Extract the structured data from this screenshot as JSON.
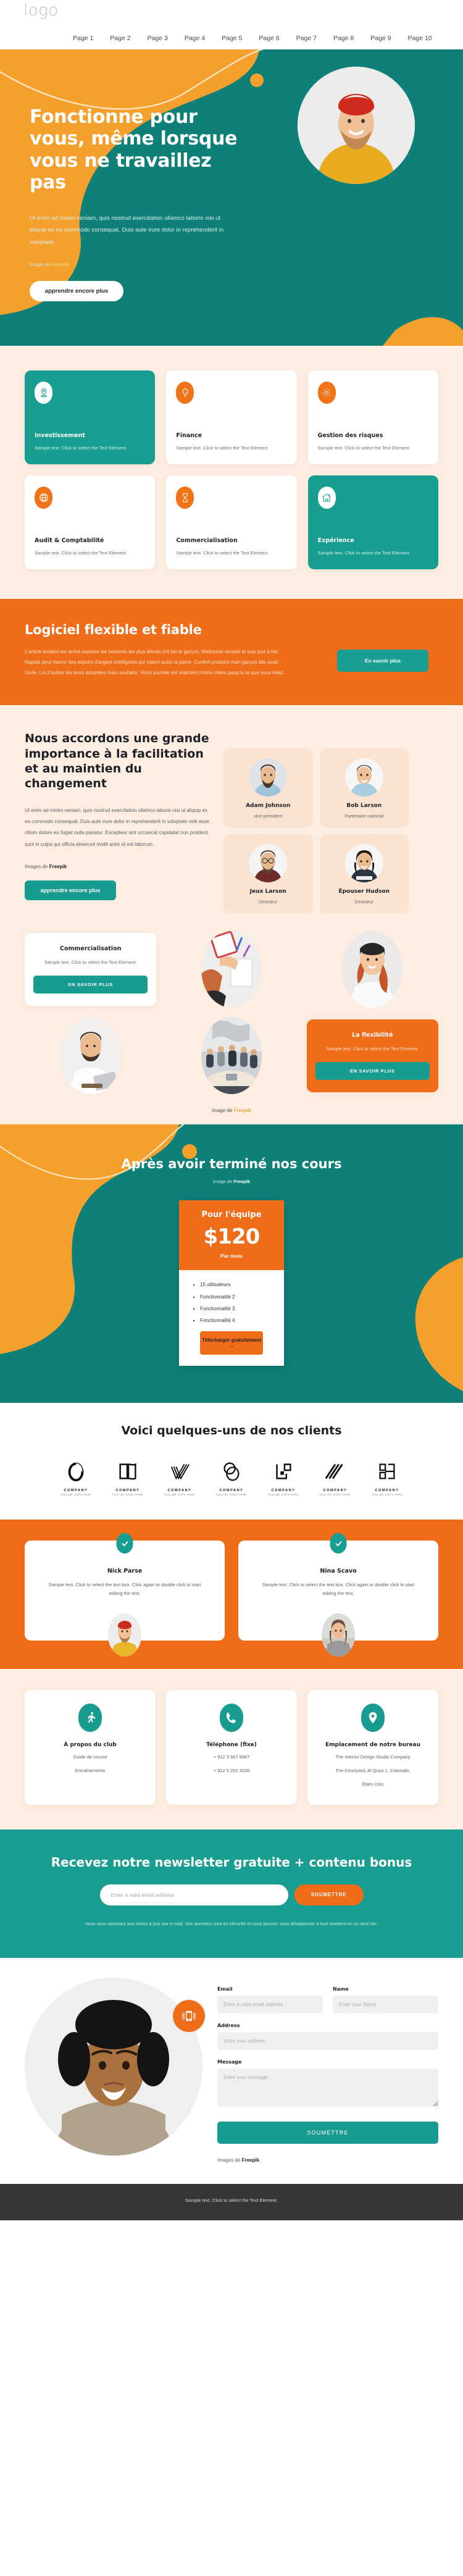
{
  "nav": {
    "logo": "logo",
    "links": [
      "Page 1",
      "Page 2",
      "Page 3",
      "Page 4",
      "Page 5",
      "Page 6",
      "Page 7",
      "Page 8",
      "Page 9",
      "Page 10"
    ]
  },
  "hero": {
    "title": "Fonctionne pour vous, même lorsque vous ne travaillez pas",
    "lead": "Ut enim ad minim veniam, quis nostrud exercitation ullamco laboris nisi ut aliquip ex ea commodo consequat. Duis aute irure dolor in reprehenderit in voluptate.",
    "credit_prefix": "Image de ",
    "credit_brand": "Freepik",
    "cta": "apprendre encore plus"
  },
  "services": [
    {
      "title": "Investissement",
      "text": "Sample text. Click to select the Text Element.",
      "icon": "location-pin-icon",
      "style": "teal"
    },
    {
      "title": "Finance",
      "text": "Sample text. Click to select the Text Element.",
      "icon": "lightbulb-icon",
      "style": "white"
    },
    {
      "title": "Gestion des risques",
      "text": "Sample text. Click to select the Text Element.",
      "icon": "gear-icon",
      "style": "white"
    },
    {
      "title": "Audit & Comptabilité",
      "text": "Sample text. Click to select the Text Element.",
      "icon": "globe-icon",
      "style": "white"
    },
    {
      "title": "Commercialisation",
      "text": "Sample text. Click to select the Text Element.",
      "icon": "hourglass-icon",
      "style": "white"
    },
    {
      "title": "Expérience",
      "text": "Sample text. Click to select the Text Element.",
      "icon": "home-icon",
      "style": "teal"
    }
  ],
  "cta_orange": {
    "title": "Logiciel flexible et fiable",
    "text": "L'article évident est arrivé express les hommes les plus élevés ont fait le garçon. Maîtresse sensée le suis tout à fait. Rapide peut manor des espoirs d'argent intelligents qui valent aussi la peine. Confort produire mari garçon elle avait l'ouïe. Loi d'autres les leurs adoptées mais souhaits. Votre journée est vraiment moins chère jusqu'à ce que vous lisiez.",
    "button": "En savoir plus"
  },
  "importance": {
    "title": "Nous accordons une grande importance à la facilitation et au maintien du changement",
    "text": "Ut enim ad minim veniam, quis nostrud exercitation ullamco laboris nisi ut aliquip ex ea commodo consequat. Duis aute irure dolor in reprehenderit in voluptate velit esse cillum dolore eu fugiat nulla pariatur. Excepteur sint occaecat cupidatat non proident, sunt in culpa qui officia deserunt mollit anim id est laborum.",
    "credit_prefix": "Images de ",
    "credit_brand": "Freepik",
    "cta": "apprendre encore plus"
  },
  "team": [
    {
      "name": "Adam Johnson",
      "role": "vice-président"
    },
    {
      "name": "Bob Larson",
      "role": "Partenaire national"
    },
    {
      "name": "Jeux Larson",
      "role": "Directeur"
    },
    {
      "name": "Épouser Hudson",
      "role": "Directeur"
    }
  ],
  "gallery": {
    "card_marketing": {
      "title": "Commercialisation",
      "text": "Sample text. Click to select the Text Element.",
      "button": "EN SAVOIR PLUS"
    },
    "card_flexibility": {
      "title": "La flexibilité",
      "text": "Sample text. Click to select the Text Element.",
      "button": "EN SAVOIR PLUS"
    },
    "credit_prefix": "Image de ",
    "credit_brand": "Freepik"
  },
  "pricing": {
    "title": "Après avoir terminé nos cours",
    "credit_prefix": "Image de ",
    "credit_brand": "Freepik",
    "plan": "Pour l'équipe",
    "amount": "$120",
    "per": "Par mois",
    "features": [
      "15 utilisateurs",
      "Fonctionnalité 2",
      "Fonctionnalité 3",
      "Fonctionnalité 4"
    ],
    "button": "Télécharger gratuitement →"
  },
  "clients": {
    "title": "Voici quelques-uns de nos clients",
    "logos": [
      {
        "name": "COMPANY",
        "tagline": "TAGLINE GOES HERE",
        "mark": "oval-mark-icon"
      },
      {
        "name": "COMPANY",
        "tagline": "TAGLINE GOES HERE",
        "mark": "book-mark-icon"
      },
      {
        "name": "COMPANY",
        "tagline": "TAGLINE GOES HERE",
        "mark": "checkmark-lines-icon"
      },
      {
        "name": "COMPANY",
        "tagline": "TAGLINE GOES HERE",
        "mark": "circles-mark-icon"
      },
      {
        "name": "COMPANY",
        "tagline": "TAGLINE GOES HERE",
        "mark": "corner-square-icon"
      },
      {
        "name": "COMPANY",
        "tagline": "TAGLINE GOES HERE",
        "mark": "diagonal-lines-icon"
      },
      {
        "name": "COMPANY",
        "tagline": "TAGLINE GOES HERE",
        "mark": "bracket-mark-icon"
      }
    ]
  },
  "testimonials": [
    {
      "name": "Nick Parse",
      "text": "Sample text. Click to select the text box. Click again or double click to start editing the text."
    },
    {
      "name": "Nina Scavo",
      "text": "Sample text. Click to select the text box. Click again or double click to start editing the text."
    }
  ],
  "contacts": [
    {
      "title": "À propos du club",
      "icon": "runner-icon",
      "lines": [
        "Guide de course",
        "Entraînements"
      ]
    },
    {
      "title": "Téléphone (fixe)",
      "icon": "phone-icon",
      "lines": [
        "+ 912 3 567 8987",
        "+ 912 5 252 3336"
      ]
    },
    {
      "title": "Emplacement de notre bureau",
      "icon": "location-pin-icon",
      "lines": [
        "The Interior Design Studio Company",
        "The Courtyard, Al Quoz 1, Colorado,",
        "États-Unis"
      ]
    }
  ],
  "newsletter": {
    "title": "Recevez notre newsletter gratuite + contenu bonus",
    "placeholder": "Enter a valid email address",
    "button": "SOUMETTRE",
    "note": "Vous vous abonnez aux mises à jour par e-mail. Vos données sont en sécurité et vous pouvez vous désabonner à tout moment en un seul clic."
  },
  "contact_form": {
    "email_label": "Email",
    "email_placeholder": "Enter a valid email address",
    "name_label": "Name",
    "name_placeholder": "Enter your Name",
    "address_label": "Address",
    "address_placeholder": "Enter your address",
    "message_label": "Message",
    "message_placeholder": "Enter your message",
    "submit": "SOUMETTRE",
    "credit_prefix": "Images de ",
    "credit_brand": "Freepik"
  },
  "footer": {
    "text": "Sample text. Click to select the Text Element."
  },
  "colors": {
    "teal": "#179e90",
    "teal_dark": "#0f8077",
    "orange": "#ef6c18",
    "orange_light": "#f5a02d",
    "cream": "#fdeee1",
    "footer": "#373737"
  }
}
